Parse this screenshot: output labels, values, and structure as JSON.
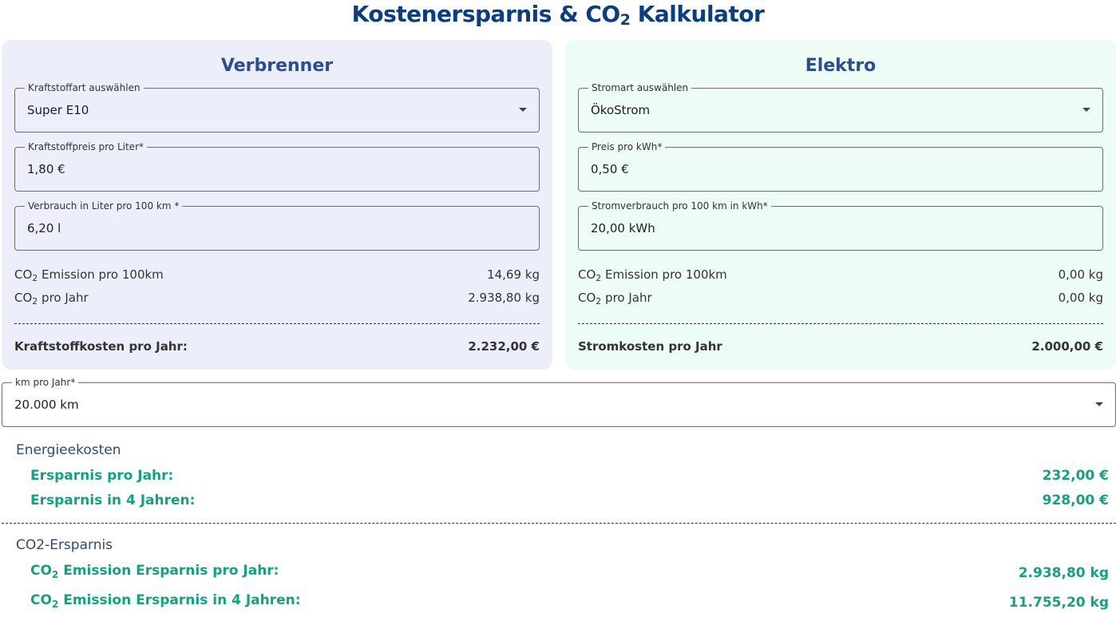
{
  "title": {
    "main": "Kostenersparnis & CO",
    "sub": "2",
    "rest": " Kalkulator"
  },
  "verbrenner": {
    "title": "Verbrenner",
    "fuel_type": {
      "label": "Kraftstoffart auswählen",
      "value": "Super E10"
    },
    "fuel_price": {
      "label": "Kraftstoffpreis pro Liter*",
      "value": "1,80 €"
    },
    "consumption": {
      "label": "Verbrauch in Liter pro 100 km *",
      "value": "6,20 l"
    },
    "co2_per_100km": {
      "label_a": "CO",
      "label_sub": "2",
      "label_b": " Emission pro 100km",
      "value": "14,69 kg"
    },
    "co2_per_year": {
      "label_a": "CO",
      "label_sub": "2",
      "label_b": " pro Jahr",
      "value": "2.938,80 kg"
    },
    "total": {
      "label": "Kraftstoffkosten pro Jahr:",
      "value": "2.232,00 €"
    }
  },
  "elektro": {
    "title": "Elektro",
    "power_type": {
      "label": "Stromart auswählen",
      "value": "ÖkoStrom"
    },
    "price": {
      "label": "Preis pro kWh*",
      "value": "0,50 €"
    },
    "consumption": {
      "label": "Stromverbrauch pro 100 km in kWh*",
      "value": "20,00 kWh"
    },
    "co2_per_100km": {
      "label_a": "CO",
      "label_sub": "2",
      "label_b": " Emission pro 100km",
      "value": "0,00 kg"
    },
    "co2_per_year": {
      "label_a": "CO",
      "label_sub": "2",
      "label_b": " pro Jahr",
      "value": "0,00 kg"
    },
    "total": {
      "label": "Stromkosten pro Jahr",
      "value": "2.000,00 €"
    }
  },
  "km": {
    "label": "km pro Jahr*",
    "value": "20.000 km"
  },
  "energy": {
    "heading": "Energieekosten",
    "per_year": {
      "label": "Ersparnis pro Jahr:",
      "value": "232,00 €"
    },
    "four_years": {
      "label": "Ersparnis in 4 Jahren:",
      "value": "928,00 €"
    }
  },
  "co2": {
    "heading": "CO2-Ersparnis",
    "per_year": {
      "label_a": "CO",
      "label_sub": "2",
      "label_b": " Emission Ersparnis pro Jahr:",
      "value": "2.938,80 kg"
    },
    "four_years": {
      "label_a": "CO",
      "label_sub": "2",
      "label_b": " Emission Ersparnis in 4 Jahren:",
      "value": "11.755,20 kg"
    }
  },
  "colors": {
    "title": "#0c3d7d",
    "card_title": "#2a4e8e",
    "saving": "#14a183",
    "ice_bg": "#eceefc",
    "ev_bg": "#edfcf4"
  },
  "icons": {
    "dropdown": "caret-down-icon"
  }
}
